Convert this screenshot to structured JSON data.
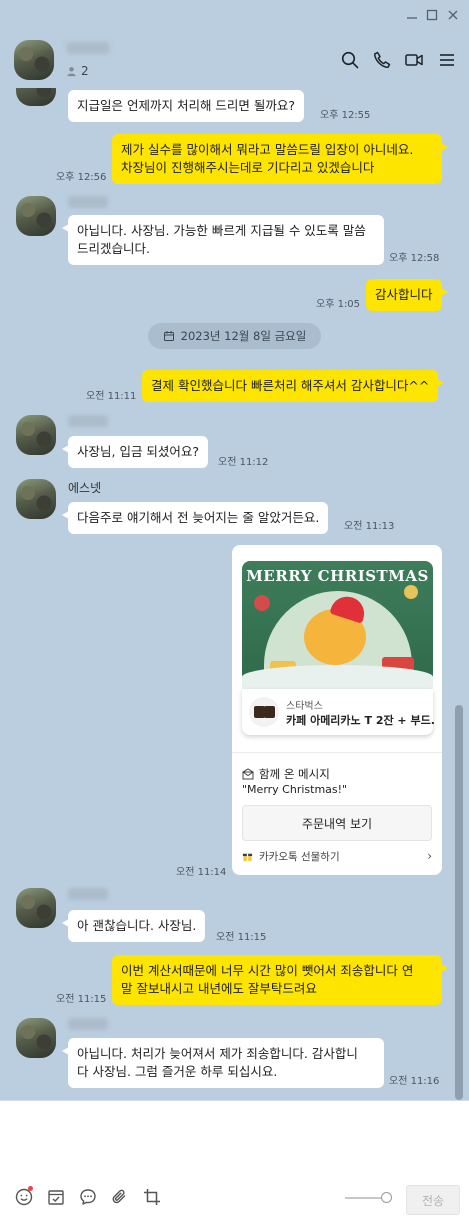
{
  "header": {
    "member_count": "2"
  },
  "messages": [
    {
      "text": "지급일은 언제까지 처리해 드리면 될까요?",
      "time": "오후 12:55"
    },
    {
      "text": "제가 실수를 많이해서 뭐라고 말씀드릴 입장이 아니네요.\n차장님이 진행해주시는데로 기다리고 있겠습니다",
      "time": "오후 12:56"
    },
    {
      "text": "아닙니다. 사장님. 가능한 빠르게 지급될 수 있도록 말씀\n드리겠습니다.",
      "time": "오후 12:58"
    },
    {
      "text": "감사합니다",
      "time": "오후 1:05"
    },
    {
      "text": "결제 확인했습니다 빠른처리 해주셔서 감사합니다^^",
      "time": "오전 11:11"
    },
    {
      "text": "사장님, 입금 되셨어요?",
      "time": "오전 11:12"
    },
    {
      "sender": "에스넷",
      "text": "다음주로 얘기해서 전 늦어지는 줄 알았거든요.",
      "time": "오전 11:13"
    },
    {
      "time": "오전 11:14"
    },
    {
      "text": "아 괜찮습니다. 사장님.",
      "time": "오전 11:15"
    },
    {
      "text": "이번 계산서때문에 너무 시간 많이 뺏어서 죄송합니다 연\n말 잘보내시고 내년에도 잘부탁드려요",
      "time": "오전 11:15"
    },
    {
      "text": "아닙니다. 처리가 늦어져서 제가 죄송합니다. 감사합니\n다 사장님. 그럼 즐거운 하루 되십시요.",
      "time": "오전 11:16"
    }
  ],
  "date_divider": "2023년 12월 8일 금요일",
  "gift": {
    "card_title": "MERRY CHRISTMAS",
    "brand": "스타벅스",
    "product_name": "카페 아메리카노 T 2잔 + 부드.",
    "message_label": "함께 온 메시지",
    "message": "\"Merry Christmas!\"",
    "order_button": "주문내역 보기",
    "footer": "카카오톡 선물하기"
  },
  "input": {
    "send_label": "전송"
  },
  "colors": {
    "background": "#bacee0",
    "outgoing_bubble": "#fee500",
    "incoming_bubble": "#ffffff"
  }
}
